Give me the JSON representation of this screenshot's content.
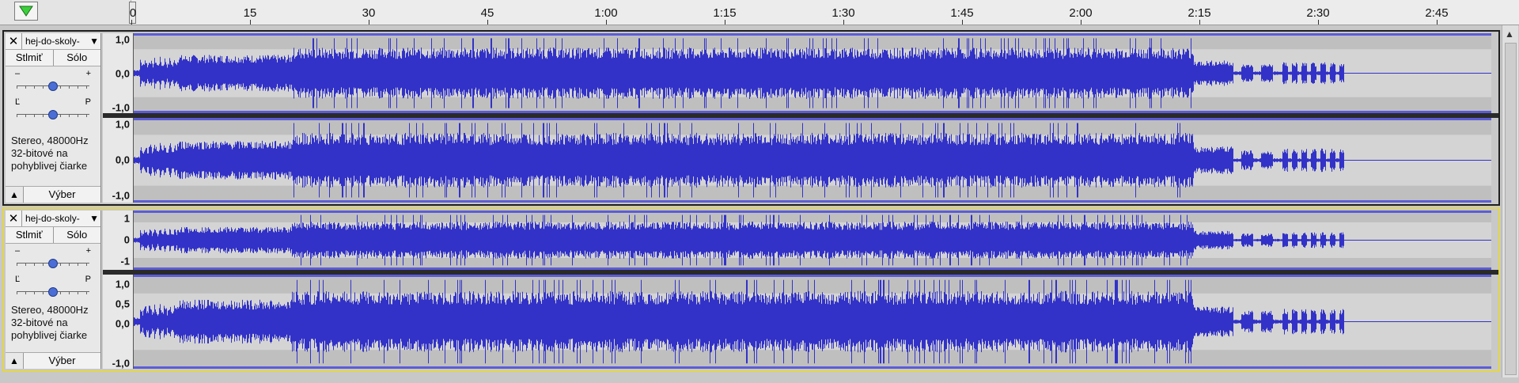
{
  "ruler": {
    "ticks": [
      "0",
      "15",
      "30",
      "45",
      "1:00",
      "1:15",
      "1:30",
      "1:45",
      "2:00",
      "2:15",
      "2:30",
      "2:45"
    ]
  },
  "tracks": [
    {
      "name": "hej-do-skoly-",
      "mute_label": "Stlmiť",
      "solo_label": "Sólo",
      "gain_minus": "–",
      "gain_plus": "+",
      "pan_left": "Ľ",
      "pan_right": "P",
      "info_line1": "Stereo, 48000Hz",
      "info_line2": "32-bitové na",
      "info_line3": "pohyblivej čiarke",
      "select_label": "Výber",
      "selected": false,
      "scale_top": [
        "1,0",
        "0,0",
        "-1,0"
      ],
      "scale_bottom": [
        "1,0",
        "0,0",
        "-1,0"
      ]
    },
    {
      "name": "hej-do-skoly-",
      "mute_label": "Stlmiť",
      "solo_label": "Sólo",
      "gain_minus": "–",
      "gain_plus": "+",
      "pan_left": "Ľ",
      "pan_right": "P",
      "info_line1": "Stereo, 48000Hz",
      "info_line2": "32-bitové na",
      "info_line3": "pohyblivej čiarke",
      "select_label": "Výber",
      "selected": true,
      "scale_top": [
        "1",
        "0",
        "-1"
      ],
      "scale_bottom": [
        "1,0",
        "0,5",
        "0,0",
        "-1,0"
      ]
    }
  ],
  "colors": {
    "waveform": "#3232c8",
    "selected_border": "#e4d64a",
    "clip_bar": "#5c5cd6"
  }
}
